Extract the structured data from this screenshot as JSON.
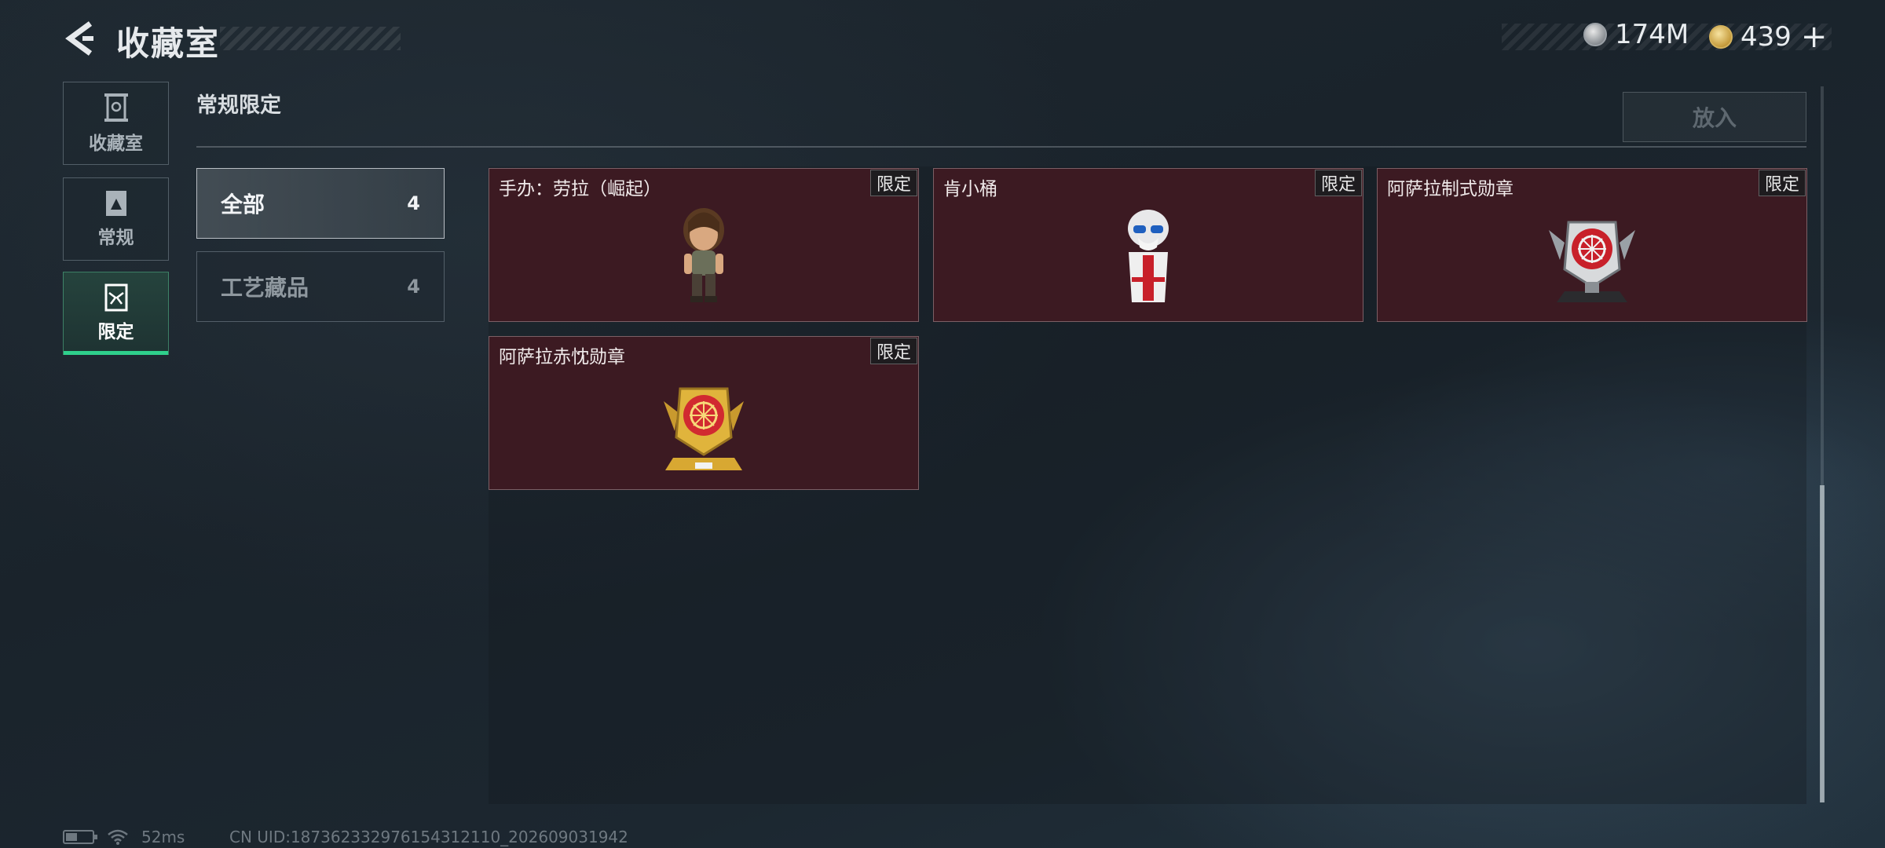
{
  "header": {
    "title": "收藏室",
    "currencies": [
      {
        "icon": "silver-coin-icon",
        "value": "174M"
      },
      {
        "icon": "gold-coin-icon",
        "value": "439"
      }
    ],
    "add_label": "+"
  },
  "side_tabs": [
    {
      "label": "收藏室",
      "icon": "cabinet-icon",
      "active": false
    },
    {
      "label": "常规",
      "icon": "document-icon",
      "active": false
    },
    {
      "label": "限定",
      "icon": "limited-icon",
      "active": true
    }
  ],
  "section": {
    "title": "常规限定",
    "put_button": "放入"
  },
  "filters": [
    {
      "label": "全部",
      "count": "4",
      "selected": true
    },
    {
      "label": "工艺藏品",
      "count": "4",
      "selected": false
    }
  ],
  "items": [
    {
      "name": "手办：劳拉（崛起）",
      "badge": "限定",
      "art": "lara-figure-icon"
    },
    {
      "name": "肯小桶",
      "badge": "限定",
      "art": "colonel-bucket-icon"
    },
    {
      "name": "阿萨拉制式勋章",
      "badge": "限定",
      "art": "red-medal-icon"
    },
    {
      "name": "阿萨拉赤忱勋章",
      "badge": "限定",
      "art": "gold-medal-icon"
    }
  ],
  "footer": {
    "ping": "52ms",
    "uid": "CN UID:1873623329761543121​10_202609031942"
  },
  "colors": {
    "accent": "#2fd08c",
    "card_bg": "#3c1a22"
  }
}
